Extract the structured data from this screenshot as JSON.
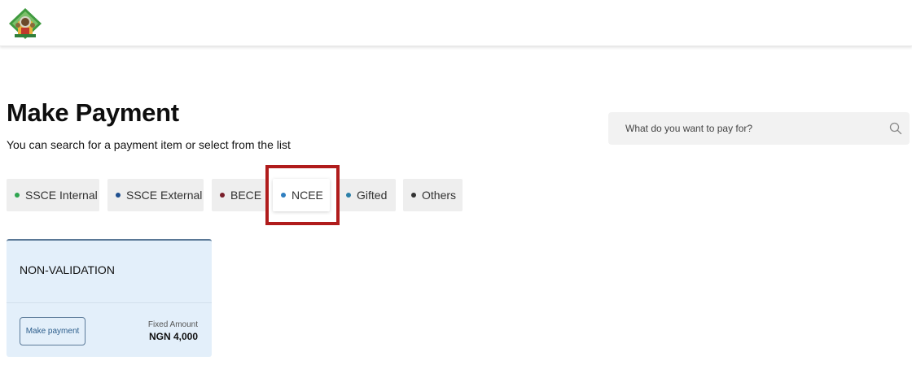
{
  "header": {
    "logo_icon": "state-crest-logo-icon"
  },
  "page": {
    "title": "Make Payment",
    "subtitle": "You can search for a payment item or select from the list"
  },
  "search": {
    "placeholder": "What do you want to pay for?",
    "icon": "search-icon"
  },
  "tabs": [
    {
      "label": "SSCE Internal",
      "dot_color": "#2ea44f",
      "active": false
    },
    {
      "label": "SSCE External",
      "dot_color": "#1f4f8f",
      "active": false
    },
    {
      "label": "BECE",
      "dot_color": "#7a1f2b",
      "active": false
    },
    {
      "label": "NCEE",
      "dot_color": "#2f7fc0",
      "active": true
    },
    {
      "label": "Gifted",
      "dot_color": "#2b7fa8",
      "active": false
    },
    {
      "label": "Others",
      "dot_color": "#333333",
      "active": false
    }
  ],
  "highlight_color": "#b01c1c",
  "payment_items": [
    {
      "title": "NON-VALIDATION",
      "button_label": "Make payment",
      "amount_label": "Fixed Amount",
      "amount_value": "NGN 4,000"
    }
  ]
}
